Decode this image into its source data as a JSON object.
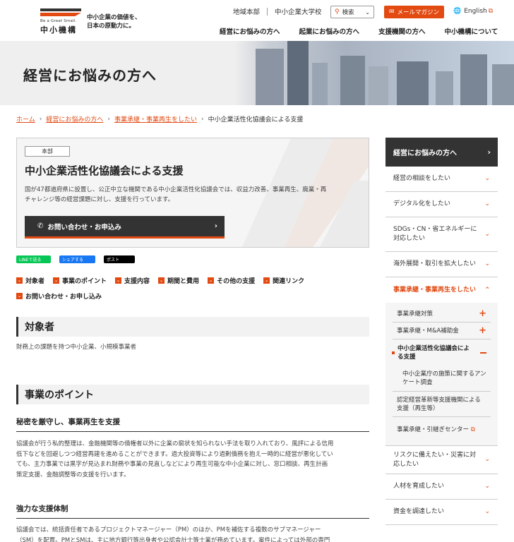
{
  "header": {
    "logo_en": "Be a Great Small.",
    "logo_jp": "中小機構",
    "tagline_line1": "中小企業の価値を、",
    "tagline_line2": "日本の原動力に。",
    "top_links": [
      "地域本部",
      "中小企業大学校"
    ],
    "search_label": "検索",
    "mail_label": "メールマガジン",
    "english_label": "English",
    "nav": [
      "経営にお悩みの方へ",
      "起業にお悩みの方へ",
      "支援機関の方へ",
      "中小機構について"
    ]
  },
  "hero": {
    "title": "経営にお悩みの方へ"
  },
  "breadcrumb": {
    "items": [
      "ホーム",
      "経営にお悩みの方へ",
      "事業承継・事業再生をしたい"
    ],
    "current": "中小企業活性化協議会による支援"
  },
  "card": {
    "badge": "本部",
    "title": "中小企業活性化協議会による支援",
    "desc_line1": "国が47都道府県に設置し、公正中立な機関である中小企業活性化協議会では、収益力改善、事業再生、廃業・再",
    "desc_line2": "チャレンジ等の経営課題に対し、支援を行っています。",
    "contact_label": "お問い合わせ・お申込み"
  },
  "share": {
    "line": "LINEで送る",
    "facebook": "シェアする",
    "x": "ポスト"
  },
  "anchors": {
    "row1": [
      "対象者",
      "事業のポイント",
      "支援内容",
      "期間と費用",
      "その他の支援",
      "関連リンク"
    ],
    "row2": [
      "お問い合わせ・お申し込み"
    ]
  },
  "sections": {
    "target_title": "対象者",
    "target_text": "財務上の課題を持つ中小企業、小規模事業者",
    "points_title": "事業のポイント",
    "point1_title": "秘密を厳守し、事業再生を支援",
    "point1_lines": [
      "協議会が行う私的整理は、金融機関等の債権者以外に企業の窮状を知られない手法を取り入れており、風評による信用",
      "低下などを回避しつつ経営再建を進めることができます。過大投資等により過剰債務を抱え一時的に経営が悪化してい",
      "ても、主力事業では黒字が見込まれ財務や事業の見直しなどにより再生可能な中小企業に対し、窓口相談、再生計画",
      "策定支援、金融調整等の支援を行います。"
    ],
    "point2_title": "強力な支援体制",
    "point2_lines": [
      "協議会では、統括責任者であるプロジェクトマネージャー（PM）のほか、PMを補佐する複数のサブマネージャー",
      "（SM）を配置。PMとSMは、主に地方銀行等出身者や公認会計士等士業が務めています。案件によっては外部の専門"
    ]
  },
  "sidebar": {
    "head": "経営にお悩みの方へ",
    "items_before": [
      "経営の相談をしたい",
      "デジタル化をしたい",
      "SDGs・CN・省エネルギーに対応したい",
      "海外展開・取引を拡大したい"
    ],
    "active": "事業承継・事業再生をしたい",
    "sub_items": [
      "事業承継対策",
      "事業承継・M&A補助金",
      "中小企業活性化協議会による支援",
      "中小企業庁の施策に関するアンケート調査",
      "認定経営革新等支援機関による支援（再生等）",
      "事業承継・引継ぎセンター"
    ],
    "items_after": [
      "リスクに備えたい・災害に対応したい",
      "人材を育成したい",
      "資金を調達したい"
    ]
  }
}
